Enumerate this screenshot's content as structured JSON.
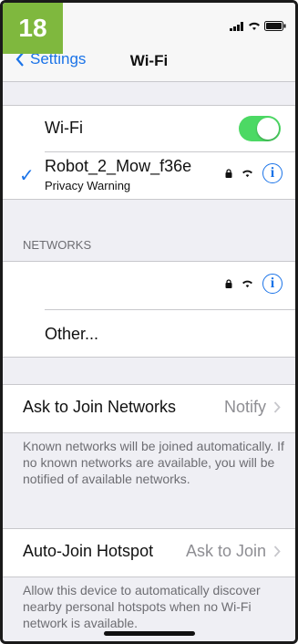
{
  "step_badge": "18",
  "nav": {
    "back_label": "Settings",
    "title": "Wi-Fi"
  },
  "wifi_toggle": {
    "label": "Wi-Fi",
    "on": true
  },
  "connected": {
    "name": "Robot_2_Mow_f36e",
    "subtitle": "Privacy Warning"
  },
  "networks": {
    "header": "NETWORKS",
    "other_label": "Other..."
  },
  "ask_to_join": {
    "label": "Ask to Join Networks",
    "value": "Notify",
    "footnote": "Known networks will be joined automatically. If no known networks are available, you will be notified of available networks."
  },
  "auto_join": {
    "label": "Auto-Join Hotspot",
    "value": "Ask to Join",
    "footnote": "Allow this device to automatically discover nearby personal hotspots when no Wi-Fi network is available."
  },
  "colors": {
    "accent": "#1a73e8",
    "toggle_on": "#4cd964",
    "badge": "#7fb83e"
  }
}
